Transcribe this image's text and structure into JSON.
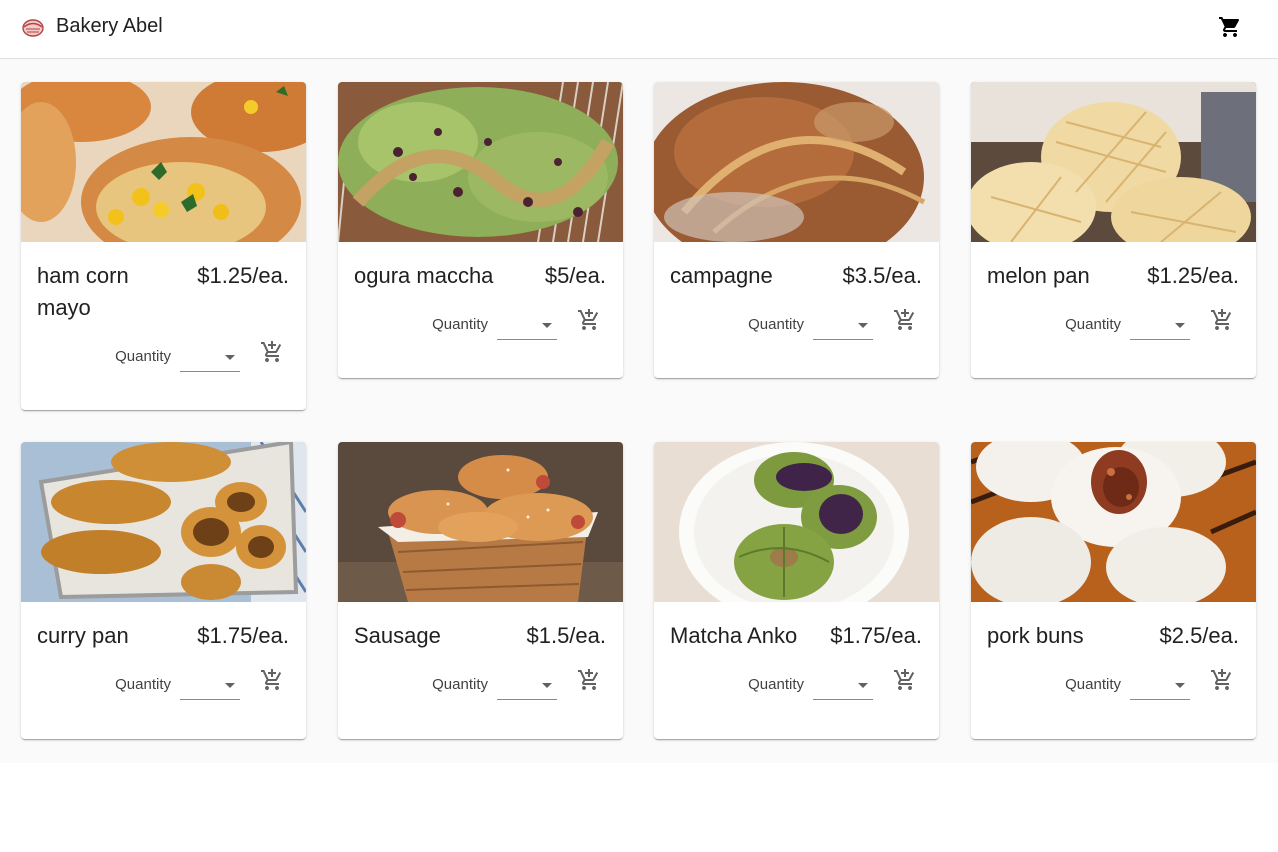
{
  "app": {
    "title": "Bakery Abel"
  },
  "header": {
    "cart_icon": "shopping-cart-icon",
    "logo_icon": "bakery-logo-icon"
  },
  "products": [
    {
      "name": "ham corn mayo",
      "price": "$1.25/ea.",
      "quantity_label": "Quantity",
      "quantity_value": ""
    },
    {
      "name": "ogura maccha",
      "price": "$5/ea.",
      "quantity_label": "Quantity",
      "quantity_value": ""
    },
    {
      "name": "campagne",
      "price": "$3.5/ea.",
      "quantity_label": "Quantity",
      "quantity_value": ""
    },
    {
      "name": "melon pan",
      "price": "$1.25/ea.",
      "quantity_label": "Quantity",
      "quantity_value": ""
    },
    {
      "name": "curry pan",
      "price": "$1.75/ea.",
      "quantity_label": "Quantity",
      "quantity_value": ""
    },
    {
      "name": "Sausage",
      "price": "$1.5/ea.",
      "quantity_label": "Quantity",
      "quantity_value": ""
    },
    {
      "name": "Matcha Anko",
      "price": "$1.75/ea.",
      "quantity_label": "Quantity",
      "quantity_value": ""
    },
    {
      "name": "pork buns",
      "price": "$2.5/ea.",
      "quantity_label": "Quantity",
      "quantity_value": ""
    }
  ],
  "colors": {
    "page_background": "#fafafa",
    "card_background": "#ffffff",
    "text": "#212121",
    "icon": "#616161"
  }
}
